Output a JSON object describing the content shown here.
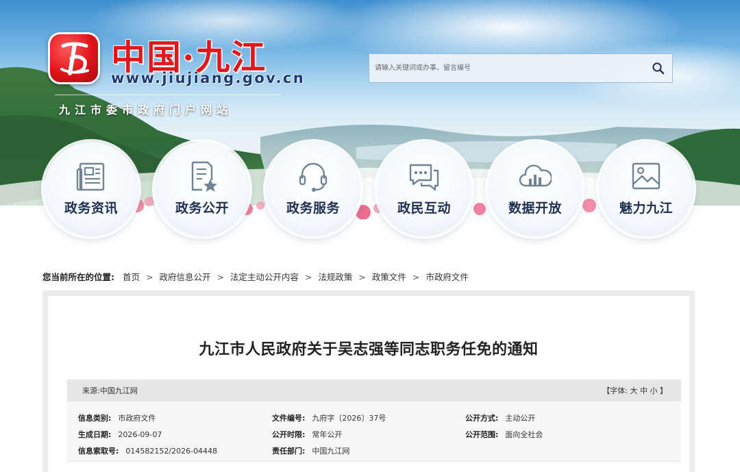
{
  "site": {
    "title": "中国·九江",
    "url": "www.jiujiang.gov.cn",
    "subtitle": "九江市委市政府门户网站"
  },
  "search": {
    "placeholder": "请输入关键词或办事、留言编号",
    "icon": "search-icon"
  },
  "nav": [
    {
      "label": "政务资讯",
      "icon": "newspaper-icon"
    },
    {
      "label": "政务公开",
      "icon": "document-star-icon"
    },
    {
      "label": "政务服务",
      "icon": "headset-icon"
    },
    {
      "label": "政民互动",
      "icon": "chat-bubbles-icon"
    },
    {
      "label": "数据开放",
      "icon": "cloud-chart-icon"
    },
    {
      "label": "魅力九江",
      "icon": "image-icon"
    }
  ],
  "breadcrumb": {
    "label": "您当前所在的位置:",
    "items": [
      "首页",
      "政府信息公开",
      "法定主动公开内容",
      "法规政策",
      "政策文件",
      "市政府文件"
    ],
    "separator": ">"
  },
  "article": {
    "title": "九江市人民政府关于吴志强等同志职务任免的通知",
    "source_label": "来源:",
    "source": "中国九江网",
    "font_size": {
      "open": "【",
      "label": "字体:",
      "large": "大",
      "medium": "中",
      "small": "小",
      "close": "】"
    }
  },
  "meta": {
    "category": {
      "key": "信息类别:",
      "value": "市政府文件"
    },
    "date": {
      "key": "生成日期:",
      "value": "2026-09-07"
    },
    "index": {
      "key": "信息索取号:",
      "value": "014582152/2026-04448"
    },
    "doc_no": {
      "key": "文件编号:",
      "value": "九府字〔2026〕37号"
    },
    "period": {
      "key": "公开时限:",
      "value": "常年公开"
    },
    "dept": {
      "key": "责任部门:",
      "value": "中国九江网"
    },
    "method": {
      "key": "公开方式:",
      "value": "主动公开"
    },
    "scope": {
      "key": "公开范围:",
      "value": "面向全社会"
    }
  },
  "colors": {
    "brand_red": "#e3161c",
    "url_navy": "#1c3a73",
    "nav_text": "#1f2f52",
    "icon_gray": "#6f8296"
  }
}
